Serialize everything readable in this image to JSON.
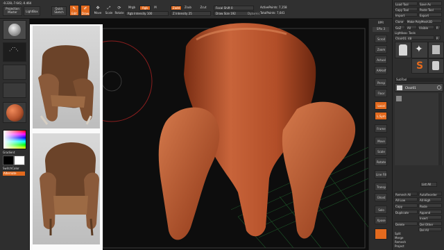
{
  "topbar": {
    "coords": "-0.228,-7.642,-0.464",
    "projection_label": "Projection",
    "projection_master_label": "Master",
    "lightbox_label": "LightBox",
    "quick_sketch_line1": "Quick",
    "quick_sketch_line2": "Sketch",
    "edit_label": "Edit",
    "draw_label": "Draw",
    "move_label": "Move",
    "scale_label": "Scale",
    "rotate_label": "Rotate",
    "mrgb_label": "Mrgb",
    "rgb_label": "Rgb",
    "m_label": "M",
    "rgb_intensity_label": "Rgb Intensity",
    "rgb_intensity_value": "100",
    "zadd_label": "Zadd",
    "zsub_label": "Zsub",
    "zcut_label": "Zcut",
    "z_intensity_label": "Z Intensity",
    "z_intensity_value": "25",
    "focal_shift_label": "Focal Shift",
    "focal_shift_value": "0",
    "draw_size_label": "Draw Size",
    "draw_size_value": "192",
    "dynamic_label": "Dynamic",
    "active_points_label": "ActivePoints:",
    "active_points_value": "7,158",
    "total_points_label": "TotalPoints:",
    "total_points_value": "7,641"
  },
  "leftshelf": {
    "gradient_label": "Gradient",
    "switch_color_label": "SwitchColor",
    "alternate_label": "Alternate"
  },
  "rightshelf": {
    "items": [
      "BPR",
      "SPix 3",
      "Scroll",
      "Zoom",
      "Actual",
      "AAHalf",
      "Persp",
      "Floor",
      "Local",
      "L.Sym",
      "Frame",
      "Move",
      "Scale",
      "Rotate",
      "Line Fill",
      "Transp",
      "Ghost",
      "Solo",
      "Xpose"
    ]
  },
  "rightpanel": {
    "load_tool": "Load Tool",
    "save_as": "Save As",
    "copy_tool": "Copy Tool",
    "paste_tool": "Paste Tool",
    "import": "Import",
    "export": "Export",
    "clone": "Clone",
    "make_polymesh": "Make PolyMesh3D",
    "goz": "GoZ",
    "all": "All",
    "visible": "Visible",
    "r": "R",
    "lightbox_tools": "Lightbox› Tools",
    "current_tool": "Chair01. 48",
    "r2": "R",
    "subtool_header": "SubTool",
    "subtool_name": "Chair01",
    "remesh_all": "Remesh All",
    "autoreorder": "AutoReorder",
    "all_low": "All Low",
    "all_high": "All High",
    "copy": "Copy",
    "paste": "Paste",
    "duplicate": "Duplicate",
    "append": "Append",
    "insert": "Insert",
    "delete": "Delete",
    "del_other": "Del Other",
    "del_all": "Del All",
    "split": "Split",
    "merge": "Merge",
    "remesh": "Remesh",
    "project": "Project",
    "list_all": "List All"
  },
  "colors": {
    "accent": "#e36a1e",
    "clay": "#b5542e",
    "viewport_bg": "#0d0d0d"
  }
}
